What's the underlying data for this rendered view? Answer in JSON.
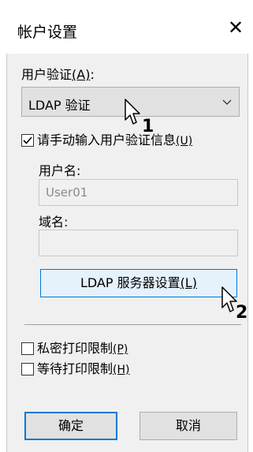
{
  "window": {
    "title": "帐户设置",
    "close_glyph": "✕"
  },
  "user_auth": {
    "label": "用户验证",
    "access_key": "(A)",
    "colon": ":",
    "selected": "LDAP 验证"
  },
  "manual_input": {
    "label": "请手动输入用户验证信息",
    "access_key": "(U)",
    "checked": true
  },
  "username": {
    "label": "用户名:",
    "value": "User01"
  },
  "domain": {
    "label": "域名:",
    "value": ""
  },
  "ldap_button": {
    "label": "LDAP 服务器设置",
    "access_key": "(L)"
  },
  "private_print": {
    "label": "私密打印限制",
    "access_key": "(P)",
    "checked": false
  },
  "hold_print": {
    "label": "等待打印限制",
    "access_key": "(H)",
    "checked": false
  },
  "buttons": {
    "ok": "确定",
    "cancel": "取消"
  },
  "callouts": {
    "one": "1",
    "two": "2"
  },
  "icons": {
    "combo_arrow": "chevron-down-icon",
    "cursor": "mouse-pointer-icon",
    "check": "checkmark-icon"
  }
}
